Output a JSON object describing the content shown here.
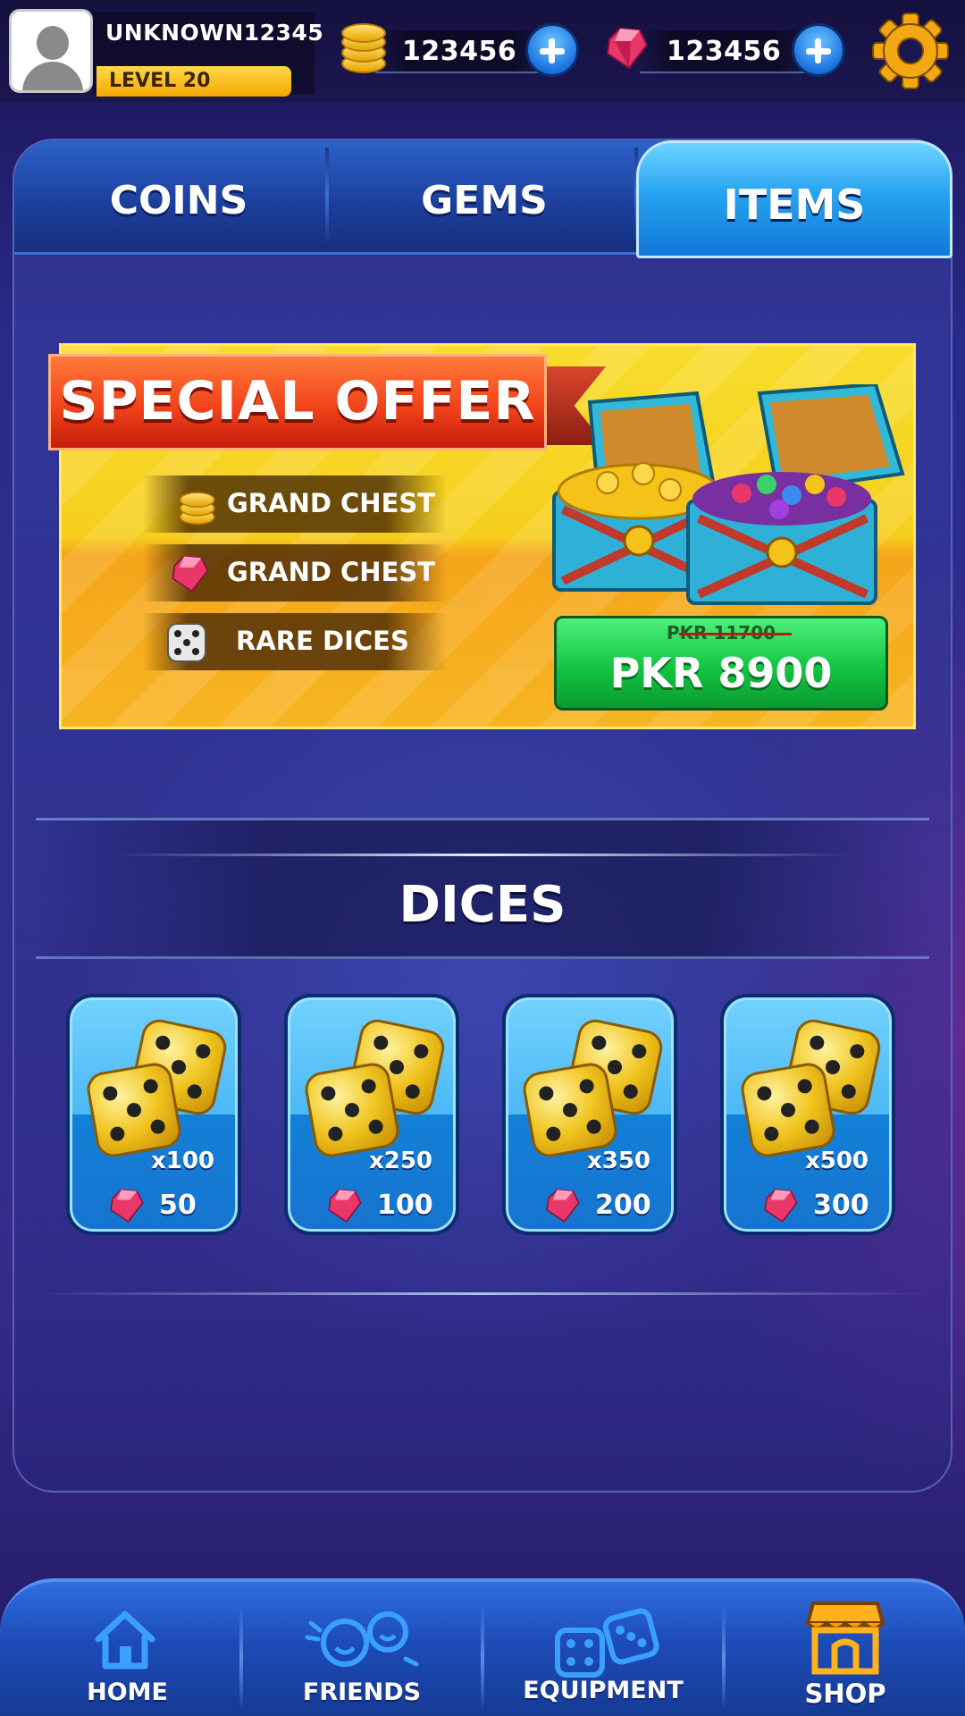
{
  "profile": {
    "username": "UNKNOWN12345",
    "level": "LEVEL 20"
  },
  "currency": {
    "coins": {
      "amount": "123456",
      "icon": "coin-icon"
    },
    "gems": {
      "amount": "123456",
      "icon": "gem-icon"
    }
  },
  "tabs": [
    {
      "label": "COINS",
      "active": false
    },
    {
      "label": "GEMS",
      "active": false
    },
    {
      "label": "ITEMS",
      "active": true
    }
  ],
  "special_offer": {
    "title": "SPECIAL OFFER",
    "items": [
      {
        "label": "GRAND CHEST",
        "icon": "coin-stack-icon"
      },
      {
        "label": "GRAND CHEST",
        "icon": "gem-icon"
      },
      {
        "label": "RARE DICES",
        "icon": "dice-icon"
      }
    ],
    "old_price": "PKR 11700",
    "price": "PKR 8900"
  },
  "dices": {
    "title": "DICES",
    "packs": [
      {
        "qty": "x100",
        "price": "50"
      },
      {
        "qty": "x250",
        "price": "100"
      },
      {
        "qty": "x350",
        "price": "200"
      },
      {
        "qty": "x500",
        "price": "300"
      }
    ]
  },
  "nav": [
    {
      "label": "HOME",
      "icon": "home-icon"
    },
    {
      "label": "FRIENDS",
      "icon": "friends-icon"
    },
    {
      "label": "EQUIPMENT",
      "icon": "dice-pair-icon"
    },
    {
      "label": "SHOP",
      "icon": "shop-icon",
      "active": true
    }
  ],
  "colors": {
    "accent": "#1b72e0",
    "gold": "#f5a800",
    "offer_green": "#14c443",
    "ribbon_red": "#f2431b"
  }
}
